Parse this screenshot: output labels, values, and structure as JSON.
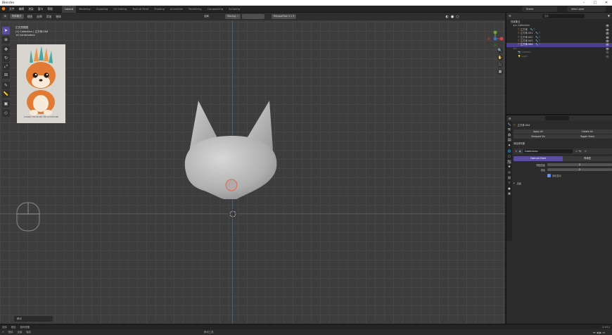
{
  "window": {
    "title": "Blender",
    "minimize_glyph": "–",
    "maximize_glyph": "□",
    "close_glyph": "✕"
  },
  "topbar": {
    "menus": [
      "文件",
      "编辑",
      "渲染",
      "窗口",
      "帮助"
    ],
    "workspaces": [
      "Layout",
      "Modeling",
      "Sculpting",
      "UV Editing",
      "Texture Paint",
      "Shading",
      "Animation",
      "Rendering",
      "Compositing",
      "Scripting"
    ],
    "scene_label": "Scene",
    "view_layer_label": "View Layer"
  },
  "viewport": {
    "mode": "物体模式",
    "header_menus": [
      "视图",
      "选择",
      "添加",
      "物体"
    ],
    "transform_orientation": "全局",
    "overlay_info": [
      "正交顶视图",
      "(1) Collection | 立方体.004",
      "10 Centimeters"
    ],
    "extra_chips": [
      "Moving ✓",
      "RetopoFlow 3.1.5"
    ],
    "pivot_chip": "物体",
    "hint": "移动"
  },
  "reference_image": {
    "caption": "CUDDLY FOX PLUSH TOY SCULPTURE",
    "colors": {
      "fox_orange": "#e07a35",
      "fox_white": "#f7ead9",
      "feather_teal": "#4aa7a0",
      "feather_orange": "#e89a4c",
      "bg_gray": "#d9d6d0"
    }
  },
  "outliner": {
    "header_label": "场景集合",
    "items": [
      {
        "label": "Collection",
        "indent": 0,
        "selected": false
      },
      {
        "label": "立方体",
        "indent": 1,
        "selected": false
      },
      {
        "label": "立方体.001",
        "indent": 1,
        "selected": false
      },
      {
        "label": "立方体.002",
        "indent": 1,
        "selected": false
      },
      {
        "label": "立方体.003",
        "indent": 1,
        "selected": false
      },
      {
        "label": "立方体.004",
        "indent": 1,
        "selected": true
      },
      {
        "label": "Camera",
        "indent": 1,
        "selected": false
      },
      {
        "label": "Light",
        "indent": 1,
        "selected": false
      }
    ],
    "search_placeholder": "搜索"
  },
  "properties": {
    "object_name": "立方体.004",
    "buttons": [
      "Apply All",
      "Delete All",
      "Viewport Vis",
      "Toggle Stack"
    ],
    "add_modifier_label": "添加修改器",
    "modifier_name": "Subdivision",
    "tabs": [
      "Catmull-Clark",
      "简单型"
    ],
    "levels_viewport_label": "视图层级",
    "levels_viewport_value": "2",
    "render_label": "渲染",
    "render_value": "2",
    "optimal_display_label": "优化显示",
    "advanced_label": "高级"
  },
  "status_bar": {
    "left_items": [
      "选择",
      "框选",
      "旋转视图"
    ],
    "middle_items": [
      "物体",
      "全局",
      "轴向"
    ],
    "version": "2.93.2",
    "hint_right": "移动工具"
  },
  "colors": {
    "accent": "#5a4da0",
    "viewport_bg": "#3d3d3d",
    "panel_bg": "#282828",
    "model_gray": "#bcbcbc",
    "axis_red": "#8a3a3a"
  }
}
